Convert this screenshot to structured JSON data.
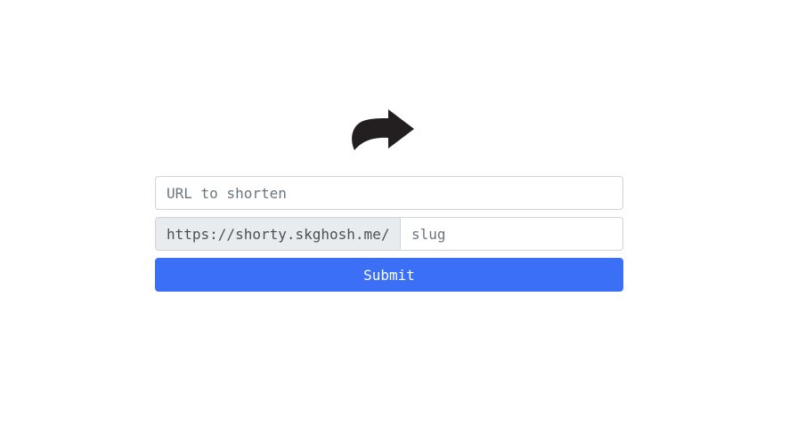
{
  "logo": {
    "icon": "share-arrow-icon",
    "color": "#231f20"
  },
  "form": {
    "url_placeholder": "URL to shorten",
    "url_value": "",
    "prefix": "https://shorty.skghosh.me/",
    "slug_placeholder": "slug",
    "slug_value": "",
    "submit_label": "Submit",
    "accent_color": "#3b6ff5"
  }
}
